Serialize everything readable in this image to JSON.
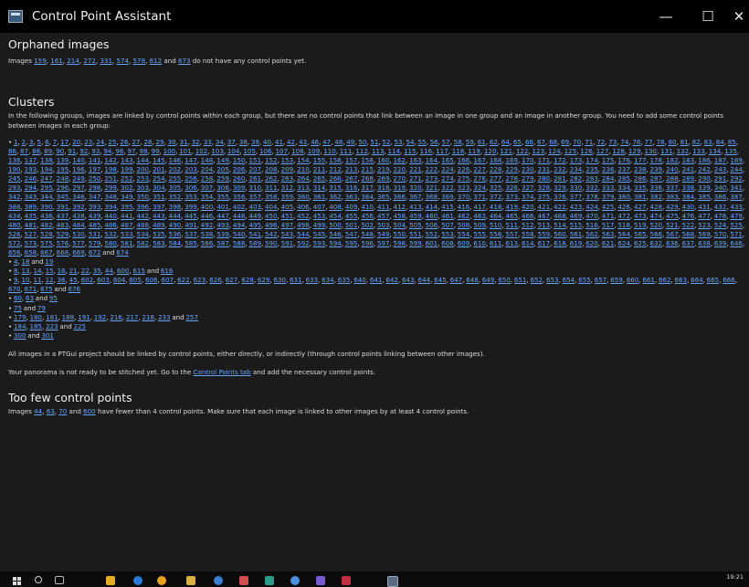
{
  "window": {
    "title": "Control Point Assistant",
    "minimize_glyph": "—",
    "maximize_glyph": "☐",
    "close_glyph": "✕"
  },
  "orphaned": {
    "heading": "Orphaned images",
    "prefix": "Images ",
    "images": [
      "159",
      "161",
      "214",
      "272",
      "331",
      "574",
      "578",
      "612",
      "673"
    ],
    "suffix": " do not have any control points yet."
  },
  "clusters": {
    "heading": "Clusters",
    "intro": "In the following groups, images are linked by control points within each group, but there are no control points that link between an image in one group and an image in another group. You need to add some control points between images in each group:",
    "groups": [
      [
        "1",
        "2",
        "3",
        "5",
        "6",
        "7",
        "17",
        "20",
        "23",
        "24",
        "25",
        "26",
        "27",
        "28",
        "29",
        "30",
        "31",
        "32",
        "33",
        "34",
        "37",
        "38",
        "39",
        "40",
        "41",
        "42",
        "43",
        "46",
        "47",
        "48",
        "49",
        "50",
        "51",
        "52",
        "53",
        "54",
        "55",
        "56",
        "57",
        "58",
        "59",
        "61",
        "62",
        "64",
        "65",
        "66",
        "67",
        "68",
        "69",
        "70",
        "71",
        "72",
        "73",
        "74",
        "76",
        "77",
        "78",
        "80",
        "81",
        "82",
        "83",
        "84",
        "85",
        "86",
        "87",
        "88",
        "89",
        "90",
        "91",
        "92",
        "93",
        "94",
        "96",
        "97",
        "98",
        "99",
        "100",
        "101",
        "102",
        "103",
        "104",
        "105",
        "106",
        "107",
        "108",
        "109",
        "110",
        "111",
        "112",
        "113",
        "114",
        "115",
        "116",
        "117",
        "118",
        "119",
        "120",
        "121",
        "122",
        "123",
        "124",
        "125",
        "126",
        "127",
        "128",
        "129",
        "130",
        "131",
        "132",
        "133",
        "134",
        "135",
        "136",
        "137",
        "138",
        "139",
        "140",
        "141",
        "142",
        "143",
        "144",
        "145",
        "146",
        "147",
        "148",
        "149",
        "150",
        "151",
        "152",
        "153",
        "154",
        "155",
        "156",
        "157",
        "158",
        "160",
        "162",
        "163",
        "164",
        "165",
        "166",
        "167",
        "168",
        "169",
        "170",
        "171",
        "172",
        "173",
        "174",
        "175",
        "176",
        "177",
        "178",
        "182",
        "183",
        "186",
        "187",
        "189",
        "190",
        "193",
        "194",
        "195",
        "196",
        "197",
        "198",
        "199",
        "200",
        "201",
        "202",
        "203",
        "204",
        "205",
        "206",
        "207",
        "208",
        "209",
        "210",
        "211",
        "212",
        "213",
        "215",
        "219",
        "220",
        "221",
        "222",
        "224",
        "226",
        "227",
        "228",
        "229",
        "230",
        "231",
        "232",
        "234",
        "235",
        "236",
        "237",
        "238",
        "239",
        "240",
        "241",
        "242",
        "243",
        "244",
        "245",
        "246",
        "247",
        "248",
        "249",
        "250",
        "251",
        "252",
        "253",
        "254",
        "255",
        "256",
        "258",
        "259",
        "260",
        "261",
        "262",
        "263",
        "264",
        "265",
        "266",
        "267",
        "268",
        "269",
        "270",
        "271",
        "273",
        "274",
        "275",
        "276",
        "277",
        "278",
        "279",
        "280",
        "281",
        "282",
        "283",
        "284",
        "285",
        "286",
        "287",
        "288",
        "289",
        "290",
        "291",
        "292",
        "293",
        "294",
        "295",
        "296",
        "297",
        "298",
        "299",
        "302",
        "303",
        "304",
        "305",
        "306",
        "307",
        "308",
        "309",
        "310",
        "311",
        "312",
        "313",
        "314",
        "315",
        "316",
        "317",
        "318",
        "319",
        "320",
        "321",
        "322",
        "323",
        "324",
        "325",
        "326",
        "327",
        "328",
        "329",
        "330",
        "332",
        "333",
        "334",
        "335",
        "336",
        "337",
        "338",
        "339",
        "340",
        "341",
        "342",
        "343",
        "344",
        "345",
        "346",
        "347",
        "348",
        "349",
        "350",
        "351",
        "352",
        "353",
        "354",
        "355",
        "356",
        "357",
        "358",
        "359",
        "360",
        "361",
        "362",
        "363",
        "364",
        "365",
        "366",
        "367",
        "368",
        "369",
        "370",
        "371",
        "372",
        "373",
        "374",
        "375",
        "376",
        "377",
        "378",
        "379",
        "380",
        "381",
        "382",
        "383",
        "384",
        "385",
        "386",
        "387",
        "388",
        "389",
        "390",
        "391",
        "392",
        "393",
        "394",
        "395",
        "396",
        "397",
        "398",
        "399",
        "400",
        "401",
        "402",
        "403",
        "404",
        "405",
        "406",
        "407",
        "408",
        "409",
        "410",
        "411",
        "412",
        "413",
        "414",
        "415",
        "416",
        "417",
        "418",
        "419",
        "420",
        "421",
        "422",
        "423",
        "424",
        "425",
        "426",
        "427",
        "428",
        "429",
        "430",
        "431",
        "432",
        "433",
        "434",
        "435",
        "436",
        "437",
        "438",
        "439",
        "440",
        "441",
        "442",
        "443",
        "444",
        "445",
        "446",
        "447",
        "448",
        "449",
        "450",
        "451",
        "452",
        "453",
        "454",
        "455",
        "456",
        "457",
        "458",
        "459",
        "460",
        "461",
        "462",
        "463",
        "464",
        "465",
        "466",
        "467",
        "468",
        "469",
        "470",
        "471",
        "472",
        "473",
        "474",
        "475",
        "476",
        "477",
        "478",
        "479",
        "480",
        "481",
        "482",
        "483",
        "484",
        "485",
        "486",
        "487",
        "488",
        "489",
        "490",
        "491",
        "492",
        "493",
        "494",
        "495",
        "496",
        "497",
        "498",
        "499",
        "500",
        "501",
        "502",
        "503",
        "504",
        "505",
        "506",
        "507",
        "508",
        "509",
        "510",
        "511",
        "512",
        "513",
        "514",
        "515",
        "516",
        "517",
        "518",
        "519",
        "520",
        "521",
        "522",
        "523",
        "524",
        "525",
        "526",
        "527",
        "528",
        "529",
        "530",
        "531",
        "532",
        "533",
        "534",
        "535",
        "536",
        "537",
        "538",
        "539",
        "540",
        "541",
        "542",
        "543",
        "544",
        "545",
        "546",
        "547",
        "548",
        "549",
        "550",
        "551",
        "552",
        "553",
        "554",
        "555",
        "556",
        "557",
        "558",
        "559",
        "560",
        "561",
        "562",
        "563",
        "564",
        "565",
        "566",
        "567",
        "568",
        "569",
        "570",
        "571",
        "572",
        "573",
        "575",
        "576",
        "577",
        "579",
        "580",
        "581",
        "582",
        "583",
        "584",
        "585",
        "586",
        "587",
        "588",
        "589",
        "590",
        "591",
        "592",
        "593",
        "594",
        "595",
        "596",
        "597",
        "598",
        "599",
        "601",
        "608",
        "609",
        "610",
        "611",
        "613",
        "614",
        "617",
        "618",
        "619",
        "620",
        "621",
        "624",
        "625",
        "632",
        "636",
        "637",
        "638",
        "639",
        "646",
        "656",
        "658",
        "667",
        "668",
        "669",
        "672",
        "674"
      ],
      [
        "4",
        "18",
        "19"
      ],
      [
        "8",
        "13",
        "14",
        "15",
        "16",
        "21",
        "22",
        "35",
        "44",
        "600",
        "615",
        "616"
      ],
      [
        "9",
        "10",
        "11",
        "12",
        "36",
        "45",
        "602",
        "603",
        "604",
        "605",
        "606",
        "607",
        "622",
        "623",
        "626",
        "627",
        "628",
        "629",
        "630",
        "631",
        "633",
        "634",
        "635",
        "640",
        "641",
        "642",
        "643",
        "644",
        "645",
        "647",
        "648",
        "649",
        "650",
        "651",
        "652",
        "653",
        "654",
        "655",
        "657",
        "659",
        "660",
        "661",
        "662",
        "663",
        "664",
        "665",
        "666",
        "670",
        "671",
        "675",
        "676"
      ],
      [
        "60",
        "63",
        "95"
      ],
      [
        "75",
        "79"
      ],
      [
        "179",
        "180",
        "181",
        "188",
        "191",
        "192",
        "216",
        "217",
        "218",
        "233",
        "257"
      ],
      [
        "184",
        "185",
        "223",
        "225"
      ],
      [
        "300",
        "301"
      ]
    ],
    "and_word": "and",
    "bullet": "•"
  },
  "linked_note": "All images in a PTGui project should be linked by control points, either directly, or indirectly (through control points linking between other images).",
  "not_ready": {
    "before": "Your panorama is not ready to be stitched yet. Go to the ",
    "link": "Control Points tab",
    "after": " and add the necessary control points."
  },
  "too_few": {
    "heading": "Too few control points",
    "prefix": "Images ",
    "images": [
      "44",
      "63",
      "70",
      "600"
    ],
    "suffix": " have fewer than 4 control points. Make sure that each image is linked to other images by at least 4 control points."
  },
  "taskbar": {
    "clock": "19:21"
  }
}
